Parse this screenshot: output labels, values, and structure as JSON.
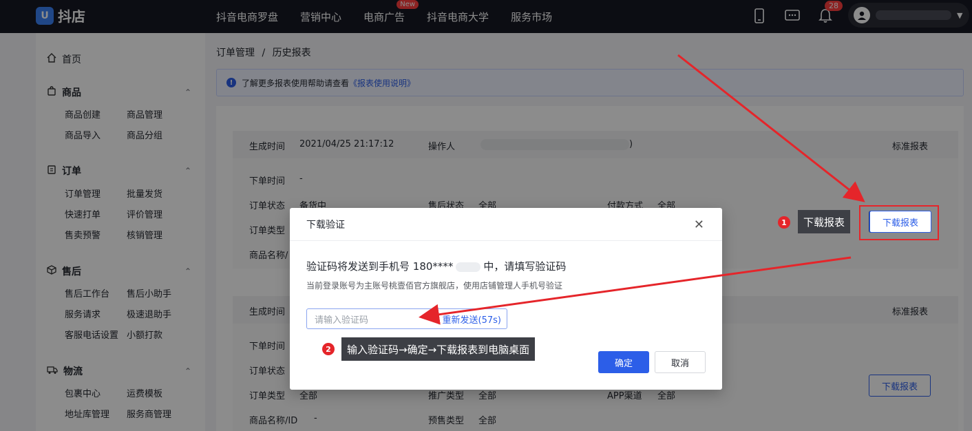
{
  "app": {
    "logo_text": "抖店",
    "logo_mark": "U"
  },
  "topnav": {
    "items": [
      "抖音电商罗盘",
      "营销中心",
      "电商广告",
      "抖音电商大学",
      "服务市场"
    ],
    "new_badge": "New",
    "bell_count": "28"
  },
  "sidebar": {
    "home": "首页",
    "sections": [
      {
        "title": "商品",
        "links": [
          "商品创建",
          "商品管理",
          "商品导入",
          "商品分组"
        ]
      },
      {
        "title": "订单",
        "links": [
          "订单管理",
          "批量发货",
          "快速打单",
          "评价管理",
          "售卖预警",
          "核销管理"
        ]
      },
      {
        "title": "售后",
        "links": [
          "售后工作台",
          "售后小助手",
          "服务请求",
          "极速退助手",
          "客服电话设置",
          "小额打款"
        ]
      },
      {
        "title": "物流",
        "links": [
          "包裹中心",
          "运费模板",
          "地址库管理",
          "服务商管理"
        ]
      }
    ]
  },
  "breadcrumb": {
    "parent": "订单管理",
    "sep": "/",
    "current": "历史报表"
  },
  "info": {
    "text": "了解更多报表使用帮助请查看",
    "link": "《报表使用说明》"
  },
  "report1": {
    "gen_time_label": "生成时间",
    "gen_time": "2021/04/25 21:17:12",
    "operator_label": "操作人",
    "operator_tail": ")",
    "type": "标准报表",
    "order_time_label": "下单时间",
    "order_time": "-",
    "order_status_label": "订单状态",
    "order_status": "备货中",
    "after_status_label": "售后状态",
    "after_status": "全部",
    "pay_label": "付款方式",
    "pay": "全部",
    "order_type_label": "订单类型",
    "goods_label": "商品名称/",
    "download": "下载报表"
  },
  "report2": {
    "gen_time_label": "生成时间",
    "type": "标准报表",
    "order_time_label": "下单时间",
    "order_status_label": "订单状态",
    "order_type_label": "订单类型",
    "order_type": "全部",
    "promo_label": "推广类型",
    "promo": "全部",
    "app_label": "APP渠道",
    "app": "全部",
    "goods_label": "商品名称/ID",
    "goods": "-",
    "presale_label": "预售类型",
    "presale": "全部",
    "download": "下载报表"
  },
  "dialog": {
    "title": "下载验证",
    "main_text_a": "验证码将发送到手机号 180****",
    "main_text_b": "中，请填写验证码",
    "sub_text": "当前登录账号为主账号桃壹佰官方旗舰店，使用店铺管理人手机号验证",
    "placeholder": "请输入验证码",
    "resend": "重新发送(57s)",
    "confirm": "确定",
    "cancel": "取消"
  },
  "annotations": {
    "step1_num": "1",
    "step1_text": "下载报表",
    "step2_num": "2",
    "step2_text": "输入验证码→确定→下载报表到电脑桌面"
  },
  "colors": {
    "accent": "#2c5ee8",
    "annotation_red": "#e5252a",
    "topbar": "#161823"
  }
}
